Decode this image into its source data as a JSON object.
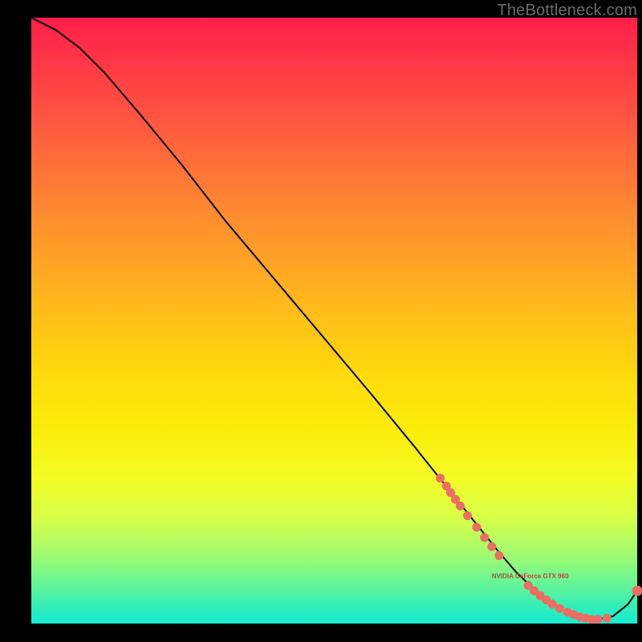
{
  "attribution": "TheBottleneck.com",
  "gpu_marker_label": "NVIDIA GeForce GTX 960",
  "colors": {
    "curve_stroke": "#000000",
    "marker_fill": "#eb6d63",
    "label_fill": "#b4483f"
  },
  "chart_data": {
    "type": "line",
    "title": "",
    "xlabel": "",
    "ylabel": "",
    "xlim": [
      0,
      100
    ],
    "ylim": [
      0,
      100
    ],
    "series": [
      {
        "name": "bottleneck-curve",
        "x": [
          0,
          4,
          8,
          12,
          18,
          25,
          32,
          40,
          48,
          56,
          63,
          69,
          73,
          77,
          80,
          83.5,
          87,
          90,
          93,
          96,
          98.5,
          100
        ],
        "y": [
          100,
          98,
          95,
          91,
          84,
          75.5,
          66.5,
          57,
          47.5,
          38,
          29.5,
          22,
          17,
          12,
          8.5,
          5.2,
          2.6,
          1.2,
          0.6,
          1.2,
          3.2,
          5.4
        ]
      }
    ],
    "markers": {
      "name": "gpu-position-cluster",
      "points_x": [
        67.5,
        68.5,
        69.2,
        70.0,
        70.8,
        72.0,
        73.5,
        74.8,
        76.0,
        77.2,
        82.0,
        83.0,
        84.0,
        85.0,
        86.0,
        87.2,
        88.5,
        89.5,
        90.5,
        91.5,
        92.5,
        93.5,
        95.0,
        100.0
      ],
      "points_y": [
        24.0,
        22.7,
        21.6,
        20.5,
        19.4,
        17.8,
        15.9,
        14.2,
        12.7,
        11.2,
        6.3,
        5.4,
        4.6,
        3.9,
        3.2,
        2.5,
        1.9,
        1.5,
        1.1,
        0.9,
        0.7,
        0.7,
        0.9,
        5.4
      ]
    },
    "label_anchor": {
      "x": 76,
      "y": 7.5
    }
  }
}
